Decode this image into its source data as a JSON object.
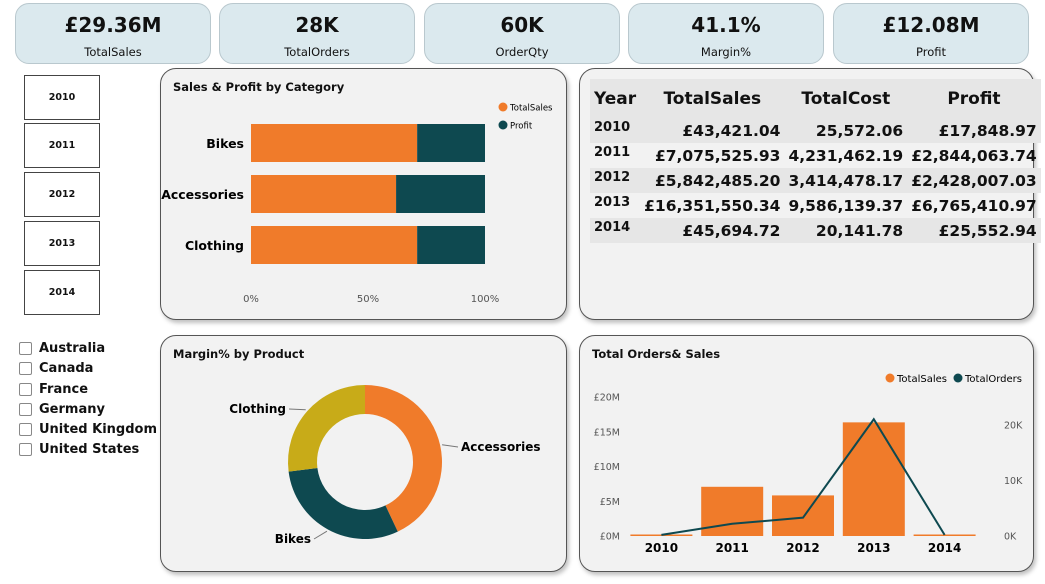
{
  "kpis": [
    {
      "value": "£29.36M",
      "label": "TotalSales"
    },
    {
      "value": "28K",
      "label": "TotalOrders"
    },
    {
      "value": "60K",
      "label": "OrderQty"
    },
    {
      "value": "41.1%",
      "label": "Margin%"
    },
    {
      "value": "£12.08M",
      "label": "Profit"
    }
  ],
  "year_slicer": [
    "2010",
    "2011",
    "2012",
    "2013",
    "2014"
  ],
  "country_slicer": [
    "Australia",
    "Canada",
    "France",
    "Germany",
    "United Kingdom",
    "United States"
  ],
  "colors": {
    "orange": "#f07b2a",
    "teal": "#0e4950",
    "gold": "#c8ab18"
  },
  "panels": {
    "category_title": "Sales & Profit by Category",
    "margin_title": "Margin% by Product",
    "orders_title": "Total Orders& Sales"
  },
  "table": {
    "headers": [
      "Year",
      "TotalSales",
      "TotalCost",
      "Profit"
    ],
    "rows": [
      [
        "2010",
        "£43,421.04",
        "25,572.06",
        "£17,848.97"
      ],
      [
        "2011",
        "£7,075,525.93",
        "4,231,462.19",
        "£2,844,063.74"
      ],
      [
        "2012",
        "£5,842,485.20",
        "3,414,478.17",
        "£2,428,007.03"
      ],
      [
        "2013",
        "£16,351,550.34",
        "9,586,139.37",
        "£6,765,410.97"
      ],
      [
        "2014",
        "£45,694.72",
        "20,141.78",
        "£25,552.94"
      ]
    ]
  },
  "chart_data": [
    {
      "type": "bar",
      "orientation": "horizontal",
      "stacked": "100%",
      "title": "Sales & Profit by Category",
      "categories": [
        "Bikes",
        "Accessories",
        "Clothing"
      ],
      "series": [
        {
          "name": "TotalSales",
          "values": [
            71,
            62,
            71
          ],
          "color": "#f07b2a"
        },
        {
          "name": "Profit",
          "values": [
            29,
            38,
            29
          ],
          "color": "#0e4950"
        }
      ],
      "xticks": [
        "0%",
        "50%",
        "100%"
      ],
      "legend": "top-right"
    },
    {
      "type": "pie",
      "variant": "donut",
      "title": "Margin% by Product",
      "labels": [
        "Accessories",
        "Bikes",
        "Clothing"
      ],
      "values": [
        43,
        30,
        27
      ],
      "colors": [
        "#f07b2a",
        "#0e4950",
        "#c8ab18"
      ]
    },
    {
      "type": "bar",
      "combo": "bar+line",
      "title": "Total Orders& Sales",
      "categories": [
        "2010",
        "2011",
        "2012",
        "2013",
        "2014"
      ],
      "series": [
        {
          "name": "TotalSales",
          "type": "bar",
          "values": [
            0.04,
            7.08,
            5.84,
            16.35,
            0.05
          ],
          "color": "#f07b2a"
        },
        {
          "name": "TotalOrders",
          "type": "line",
          "values": [
            200,
            2200,
            3300,
            21000,
            200
          ],
          "color": "#0e4950"
        }
      ],
      "yticks_left": [
        "£0M",
        "£5M",
        "£10M",
        "£15M",
        "£20M"
      ],
      "yticks_right": [
        "0K",
        "10K",
        "20K"
      ],
      "ylim_left": [
        0,
        20
      ],
      "ylim_right": [
        0,
        25000
      ],
      "legend": "top-right"
    }
  ]
}
